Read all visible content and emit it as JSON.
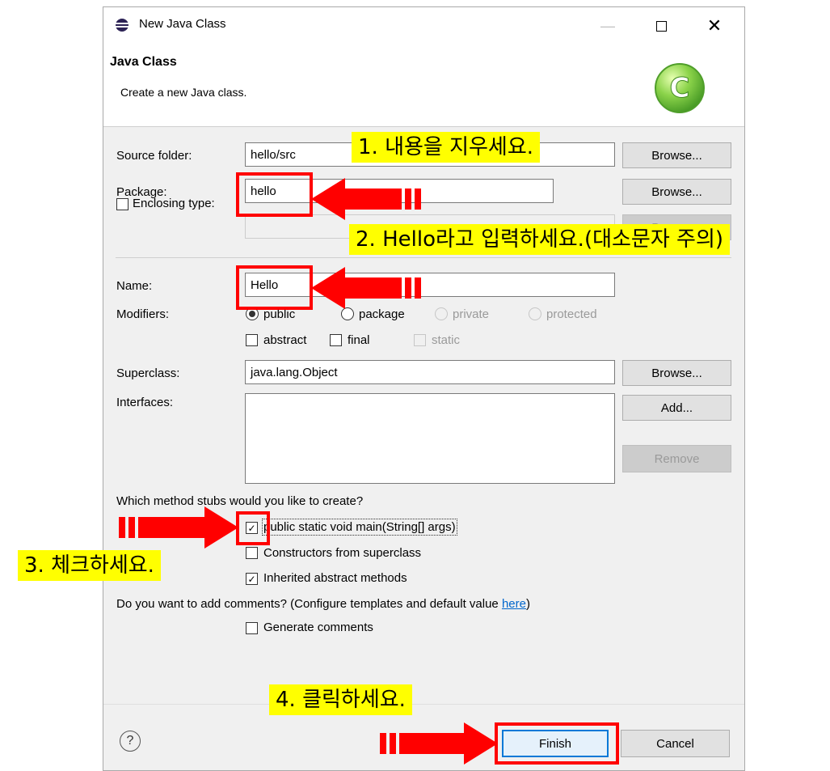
{
  "window": {
    "title": "New Java Class",
    "minimize_glyph": "—",
    "maximize_glyph": "☐",
    "close_glyph": "✕"
  },
  "header": {
    "title": "Java Class",
    "description": "Create a new Java class."
  },
  "form": {
    "source_folder": {
      "label": "Source folder:",
      "value": "hello/src",
      "browse": "Browse..."
    },
    "package": {
      "label": "Package:",
      "value": "hello",
      "browse": "Browse..."
    },
    "enclosing": {
      "label": "Enclosing type:",
      "checked": false,
      "browse": "Browse..."
    },
    "name": {
      "label": "Name:",
      "value": "Hello"
    },
    "modifiers": {
      "label": "Modifiers:",
      "options": [
        "public",
        "package",
        "private",
        "protected"
      ],
      "selected": "public",
      "checks": [
        "abstract",
        "final",
        "static"
      ]
    },
    "superclass": {
      "label": "Superclass:",
      "value": "java.lang.Object",
      "browse": "Browse..."
    },
    "interfaces": {
      "label": "Interfaces:",
      "add": "Add...",
      "remove": "Remove"
    },
    "stubs": {
      "question": "Which method stubs would you like to create?",
      "main": {
        "label": "public static void main(String[] args)",
        "checked": true
      },
      "constructors": {
        "label": "Constructors from superclass",
        "checked": false
      },
      "inherited": {
        "label": "Inherited abstract methods",
        "checked": true
      }
    },
    "comments": {
      "question": "Do you want to add comments? (Configure templates and default value ",
      "link": "here",
      "question_end": ")",
      "generate": {
        "label": "Generate comments",
        "checked": false
      }
    }
  },
  "footer": {
    "help_glyph": "?",
    "finish": "Finish",
    "cancel": "Cancel"
  },
  "annotations": {
    "step1": "1. 내용을 지우세요.",
    "step2": "2. Hello라고 입력하세요.(대소문자 주의)",
    "step3": "3. 체크하세요.",
    "step4": "4. 클릭하세요."
  },
  "colors": {
    "highlight": "#ffff00",
    "marker": "#ff0000",
    "dialog_bg": "#f0f0f0",
    "focus_blue": "#0078d7"
  }
}
